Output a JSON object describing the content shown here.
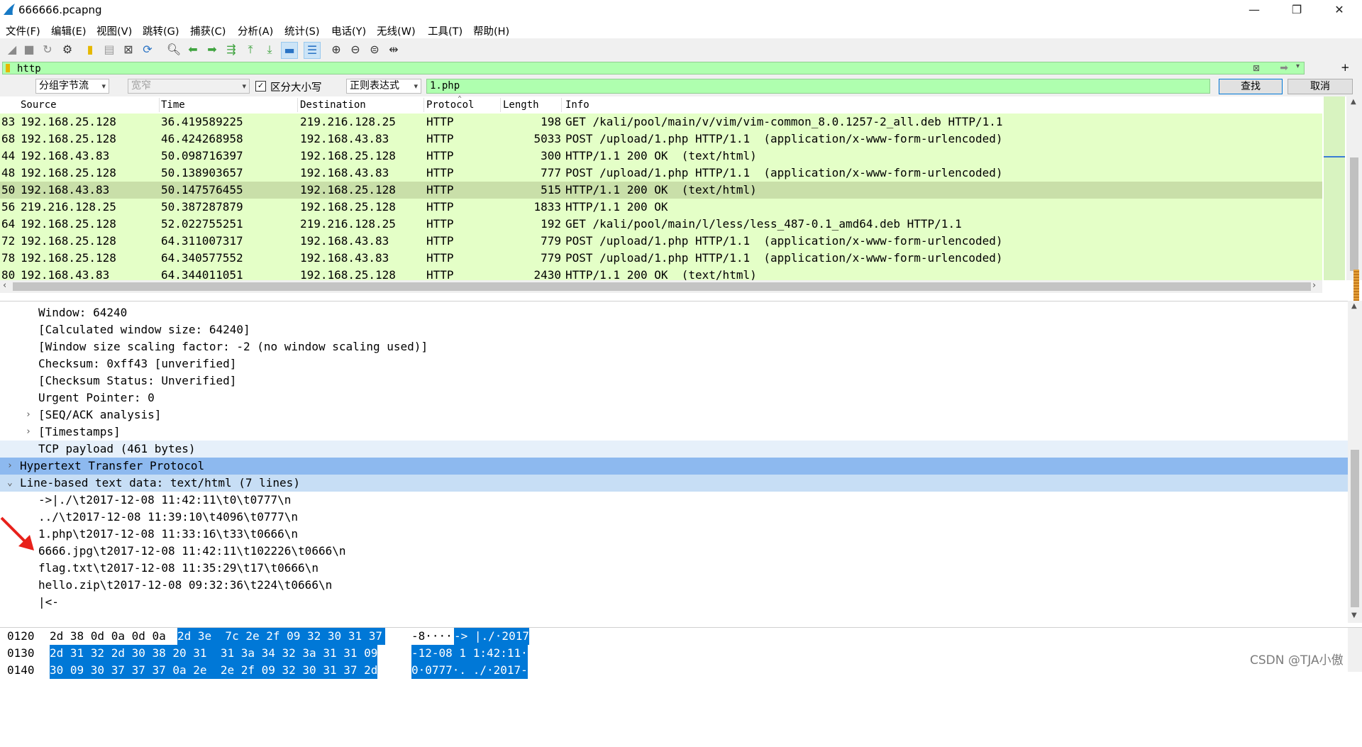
{
  "window": {
    "title": "666666.pcapng",
    "minimize": "—",
    "restore": "❐",
    "close": "✕"
  },
  "menu": [
    "文件(F)",
    "编辑(E)",
    "视图(V)",
    "跳转(G)",
    "捕获(C)",
    "分析(A)",
    "统计(S)",
    "电话(Y)",
    "无线(W)",
    "工具(T)",
    "帮助(H)"
  ],
  "toolbar_icons": [
    "shark-fin-start-icon",
    "stop-icon",
    "restart-icon",
    "options-gear-icon",
    "open-file-icon",
    "save-file-icon",
    "close-file-icon",
    "reload-icon",
    "find-packet-icon",
    "go-back-icon",
    "go-forward-icon",
    "go-to-packet-icon",
    "go-first-icon",
    "go-last-icon",
    "autoscroll-icon",
    "colorize-icon",
    "zoom-in-icon",
    "zoom-out-icon",
    "zoom-normal-icon",
    "resize-columns-icon"
  ],
  "filter": {
    "value": "http"
  },
  "find": {
    "scope": "分组字节流",
    "charset": "宽窄",
    "case_sensitive_label": "区分大小写",
    "case_sensitive": true,
    "mode": "正则表达式",
    "query": "1.php",
    "find_button": "查找",
    "cancel_button": "取消"
  },
  "packet_list": {
    "columns": [
      "Source",
      "Time",
      "Destination",
      "Protocol",
      "Length",
      "Info"
    ],
    "rows": [
      {
        "no": "83",
        "source": "192.168.25.128",
        "time": "36.419589225",
        "destination": "219.216.128.25",
        "protocol": "HTTP",
        "length": "198",
        "info": "GET /kali/pool/main/v/vim/vim-common_8.0.1257-2_all.deb HTTP/1.1"
      },
      {
        "no": "68",
        "source": "192.168.25.128",
        "time": "46.424268958",
        "destination": "192.168.43.83",
        "protocol": "HTTP",
        "length": "5033",
        "info": "POST /upload/1.php HTTP/1.1  (application/x-www-form-urlencoded)"
      },
      {
        "no": "44",
        "source": "192.168.43.83",
        "time": "50.098716397",
        "destination": "192.168.25.128",
        "protocol": "HTTP",
        "length": "300",
        "info": "HTTP/1.1 200 OK  (text/html)"
      },
      {
        "no": "48",
        "source": "192.168.25.128",
        "time": "50.138903657",
        "destination": "192.168.43.83",
        "protocol": "HTTP",
        "length": "777",
        "info": "POST /upload/1.php HTTP/1.1  (application/x-www-form-urlencoded)"
      },
      {
        "no": "50",
        "source": "192.168.43.83",
        "time": "50.147576455",
        "destination": "192.168.25.128",
        "protocol": "HTTP",
        "length": "515",
        "info": "HTTP/1.1 200 OK  (text/html)",
        "selected": true
      },
      {
        "no": "56",
        "source": "219.216.128.25",
        "time": "50.387287879",
        "destination": "192.168.25.128",
        "protocol": "HTTP",
        "length": "1833",
        "info": "HTTP/1.1 200 OK"
      },
      {
        "no": "64",
        "source": "192.168.25.128",
        "time": "52.022755251",
        "destination": "219.216.128.25",
        "protocol": "HTTP",
        "length": "192",
        "info": "GET /kali/pool/main/l/less/less_487-0.1_amd64.deb HTTP/1.1"
      },
      {
        "no": "72",
        "source": "192.168.25.128",
        "time": "64.311007317",
        "destination": "192.168.43.83",
        "protocol": "HTTP",
        "length": "779",
        "info": "POST /upload/1.php HTTP/1.1  (application/x-www-form-urlencoded)"
      },
      {
        "no": "78",
        "source": "192.168.25.128",
        "time": "64.340577552",
        "destination": "192.168.43.83",
        "protocol": "HTTP",
        "length": "779",
        "info": "POST /upload/1.php HTTP/1.1  (application/x-www-form-urlencoded)"
      },
      {
        "no": "80",
        "source": "192.168.43.83",
        "time": "64.344011051",
        "destination": "192.168.25.128",
        "protocol": "HTTP",
        "length": "2430",
        "info": "HTTP/1.1 200 OK  (text/html)"
      }
    ]
  },
  "details": [
    {
      "text": "Window: 64240",
      "indent": 2
    },
    {
      "text": "[Calculated window size: 64240]",
      "indent": 2
    },
    {
      "text": "[Window size scaling factor: -2 (no window scaling used)]",
      "indent": 2
    },
    {
      "text": "Checksum: 0xff43 [unverified]",
      "indent": 2
    },
    {
      "text": "[Checksum Status: Unverified]",
      "indent": 2
    },
    {
      "text": "Urgent Pointer: 0",
      "indent": 2
    },
    {
      "text": "[SEQ/ACK analysis]",
      "indent": 2,
      "expander": "›"
    },
    {
      "text": "[Timestamps]",
      "indent": 2,
      "expander": "›"
    },
    {
      "text": "TCP payload (461 bytes)",
      "indent": 2,
      "highlight": "pale"
    },
    {
      "text": "Hypertext Transfer Protocol",
      "indent": 1,
      "expander": "›",
      "highlight": "dark"
    },
    {
      "text": "Line-based text data: text/html (7 lines)",
      "indent": 1,
      "expander": "⌄",
      "highlight": "light"
    },
    {
      "text": "->|./\\t2017-12-08 11:42:11\\t0\\t0777\\n",
      "indent": 2
    },
    {
      "text": "../\\t2017-12-08 11:39:10\\t4096\\t0777\\n",
      "indent": 2
    },
    {
      "text": "1.php\\t2017-12-08 11:33:16\\t33\\t0666\\n",
      "indent": 2
    },
    {
      "text": "6666.jpg\\t2017-12-08 11:42:11\\t102226\\t0666\\n",
      "indent": 2
    },
    {
      "text": "flag.txt\\t2017-12-08 11:35:29\\t17\\t0666\\n",
      "indent": 2
    },
    {
      "text": "hello.zip\\t2017-12-08 09:32:36\\t224\\t0666\\n",
      "indent": 2
    },
    {
      "text": "|<-",
      "indent": 2
    }
  ],
  "bytes": [
    {
      "offset": "0120",
      "hex_plain": "2d 38 0d 0a 0d 0a",
      "hex_sel1": "2d 3e  7c 2e 2f 09 32 30 31 37",
      "ascii_plain": "-8····",
      "ascii_sel": "-> |./·2017"
    },
    {
      "offset": "0130",
      "hex_sel": "2d 31 32 2d 30 38 20 31  31 3a 34 32 3a 31 31 09",
      "ascii_sel": "-12-08 1 1:42:11·"
    },
    {
      "offset": "0140",
      "hex_sel": "30 09 30 37 37 37 0a 2e  2e 2f 09 32 30 31 37 2d",
      "ascii_sel": "0·0777·. ./·2017-"
    }
  ],
  "watermark": "CSDN @TJA小傲",
  "colors": {
    "filter_ok": "#afffaf",
    "http_row": "#e4ffc7",
    "selected_row": "#c9dfa9",
    "selection_blue": "#0078d7",
    "annotation_arrow": "#e8211b"
  }
}
